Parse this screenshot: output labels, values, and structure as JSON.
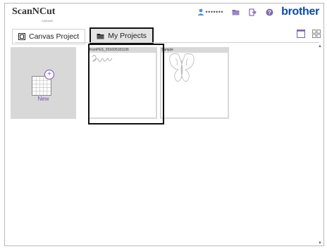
{
  "app": {
    "logo_text": "ScanNCut",
    "logo_sub": "CANVAS",
    "user_name": "•••••••",
    "brand": "brother"
  },
  "tabs": [
    {
      "label": "Canvas Project",
      "icon": "canvas-icon",
      "active": false
    },
    {
      "label": "My Projects",
      "icon": "folder-icon",
      "active": true
    }
  ],
  "tiles": {
    "new_label": "New",
    "projects": [
      {
        "title": "fromPES_201605181106",
        "thumbnail": "script-text-design",
        "selected": true
      },
      {
        "title": "Sample",
        "thumbnail": "butterfly-outline",
        "selected": false
      }
    ]
  },
  "colors": {
    "brand_blue": "#0b4aa8",
    "accent_purple": "#7a4fb5",
    "user_blue": "#4a8fd8",
    "tile_gray": "#d8d8d8"
  }
}
